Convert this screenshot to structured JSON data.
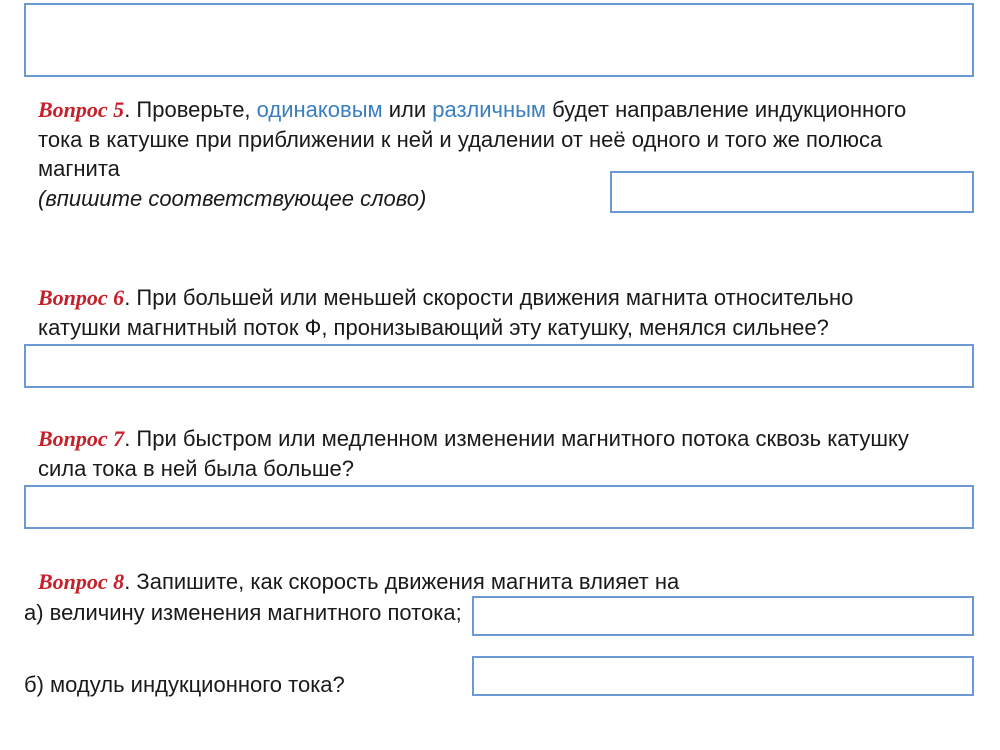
{
  "q5": {
    "label": "Вопрос 5",
    "dot": ". ",
    "pre": "Проверьте, ",
    "w1": "одинаковым",
    "mid": " или ",
    "w2": "различным",
    "post1": " будет направление индукционного",
    "line2": "тока в катушке при приближении к ней и удалении от неё одного и того же полюса",
    "line3": "магнита",
    "hint": "(впишите соответствующее слово)"
  },
  "q6": {
    "label": "Вопрос 6",
    "dot": ". ",
    "line1": "При большей или меньшей скорости движения магнита относительно",
    "line2": "катушки магнитный поток Ф, пронизывающий эту катушку, менялся сильнее?"
  },
  "q7": {
    "label": "Вопрос 7",
    "dot": ". ",
    "line1": "При быстром или медленном изменении магнитного потока сквозь катушку",
    "line2": "сила тока в ней была больше?"
  },
  "q8": {
    "label": "Вопрос 8",
    "dot": ". ",
    "line1": "Запишите, как скорость движения магнита влияет на",
    "a": "а) величину изменения магнитного потока;",
    "b": "б) модуль индукционного тока?"
  }
}
